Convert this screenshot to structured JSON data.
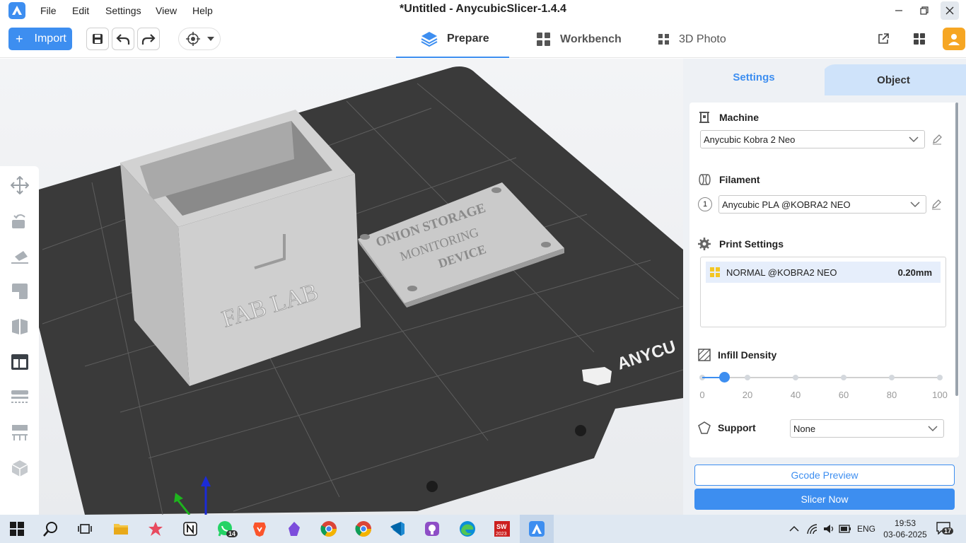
{
  "app": {
    "title": "*Untitled - AnycubicSlicer-1.4.4",
    "menu": [
      "File",
      "Edit",
      "Settings",
      "View",
      "Help"
    ]
  },
  "toolbar": {
    "import_label": "Import",
    "tabs": [
      {
        "label": "Prepare",
        "icon": "layers-icon",
        "active": true
      },
      {
        "label": "Workbench",
        "icon": "grid-icon",
        "active": false
      },
      {
        "label": "3D Photo",
        "icon": "photo-grid-icon",
        "active": false
      }
    ]
  },
  "scene": {
    "box_text": "FAB LAB",
    "plate_text": [
      "ONION STORAGE",
      "MONITORING",
      "DEVICE"
    ],
    "bed_brand": "ANYCU"
  },
  "panel": {
    "tabs": [
      "Settings",
      "Object"
    ],
    "machine": {
      "title": "Machine",
      "value": "Anycubic Kobra 2 Neo"
    },
    "filament": {
      "title": "Filament",
      "slot": "1",
      "value": "Anycubic PLA @KOBRA2 NEO"
    },
    "print_settings": {
      "title": "Print Settings",
      "profile": "NORMAL @KOBRA2 NEO",
      "layer_height": "0.20mm"
    },
    "infill": {
      "title": "Infill Density",
      "value_percent": 10,
      "ticks": [
        "0",
        "20",
        "40",
        "60",
        "80",
        "100"
      ]
    },
    "support": {
      "title": "Support",
      "value": "None"
    },
    "gcode_preview_label": "Gcode Preview",
    "slice_label": "Slicer Now"
  },
  "taskbar": {
    "whatsapp_badge": "14",
    "lang": "ENG",
    "time": "19:53",
    "date": "03-06-2025",
    "notifications": "17"
  },
  "colors": {
    "accent": "#3d8ef0",
    "bed": "#3a3a3a",
    "model": "#c9c9c9"
  }
}
